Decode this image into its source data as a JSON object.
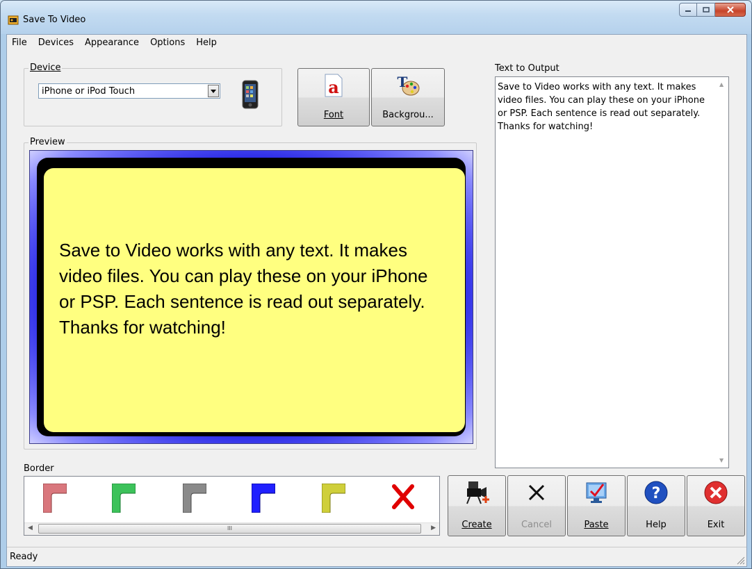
{
  "window": {
    "title": "Save To Video"
  },
  "menu": [
    "File",
    "Devices",
    "Appearance",
    "Options",
    "Help"
  ],
  "device": {
    "group_label": "Device",
    "selected": "iPhone or iPod Touch"
  },
  "buttons": {
    "font": "Font",
    "background": "Backgrou..."
  },
  "preview": {
    "group_label": "Preview",
    "text": "Save to Video works with any text. It makes video files. You can play these on your iPhone or PSP. Each sentence is read out separately. Thanks for watching!",
    "colors": {
      "card": "#ffff80",
      "frame": "#1a1aff"
    }
  },
  "output": {
    "label": "Text to Output",
    "text": "Save to Video works with any text. It makes video files. You can play these on your iPhone or PSP. Each sentence is read out separately. Thanks for watching!"
  },
  "border": {
    "label": "Border",
    "swatches": [
      {
        "name": "red",
        "color": "#d9777d"
      },
      {
        "name": "green",
        "color": "#3cc25a"
      },
      {
        "name": "gray",
        "color": "#8a8a8a"
      },
      {
        "name": "blue",
        "color": "#2020ff"
      },
      {
        "name": "yellow",
        "color": "#cfcf3a"
      },
      {
        "name": "none",
        "color": "#e00000"
      }
    ],
    "scroll_thumb_text": "III"
  },
  "actions": {
    "create": "Create",
    "cancel": "Cancel",
    "paste": "Paste",
    "help": "Help",
    "exit": "Exit"
  },
  "status": {
    "text": "Ready"
  }
}
